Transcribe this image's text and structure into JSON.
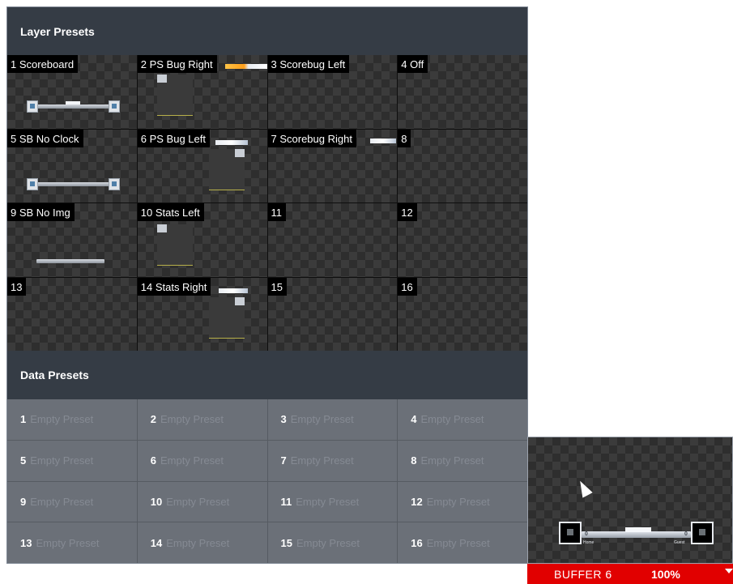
{
  "layer_presets": {
    "title": "Layer Presets",
    "items": [
      {
        "label": "1 Scoreboard"
      },
      {
        "label": "2 PS Bug Right"
      },
      {
        "label": "3 Scorebug Left"
      },
      {
        "label": "4 Off"
      },
      {
        "label": "5 SB No Clock"
      },
      {
        "label": "6 PS Bug Left"
      },
      {
        "label": "7 Scorebug Right"
      },
      {
        "label": "8"
      },
      {
        "label": "9 SB No Img"
      },
      {
        "label": "10 Stats Left"
      },
      {
        "label": "11"
      },
      {
        "label": "12"
      },
      {
        "label": "13"
      },
      {
        "label": "14 Stats Right"
      },
      {
        "label": "15"
      },
      {
        "label": "16"
      }
    ]
  },
  "data_presets": {
    "title": "Data Presets",
    "items": [
      {
        "num": "1",
        "label": "Empty Preset"
      },
      {
        "num": "2",
        "label": "Empty Preset"
      },
      {
        "num": "3",
        "label": "Empty Preset"
      },
      {
        "num": "4",
        "label": "Empty Preset"
      },
      {
        "num": "5",
        "label": "Empty Preset"
      },
      {
        "num": "6",
        "label": "Empty Preset"
      },
      {
        "num": "7",
        "label": "Empty Preset"
      },
      {
        "num": "8",
        "label": "Empty Preset"
      },
      {
        "num": "9",
        "label": "Empty Preset"
      },
      {
        "num": "10",
        "label": "Empty Preset"
      },
      {
        "num": "11",
        "label": "Empty Preset"
      },
      {
        "num": "12",
        "label": "Empty Preset"
      },
      {
        "num": "13",
        "label": "Empty Preset"
      },
      {
        "num": "14",
        "label": "Empty Preset"
      },
      {
        "num": "15",
        "label": "Empty Preset"
      },
      {
        "num": "16",
        "label": "Empty Preset"
      }
    ]
  },
  "preview": {
    "buffer_label": "BUFFER 6",
    "zoom": "100%",
    "score_home": "0",
    "score_guest": "0",
    "home_label": "Home",
    "guest_label": "Guest"
  },
  "colors": {
    "status_bar": "#e10000",
    "header_bg": "#353c45",
    "data_cell_bg": "#6b7078"
  }
}
